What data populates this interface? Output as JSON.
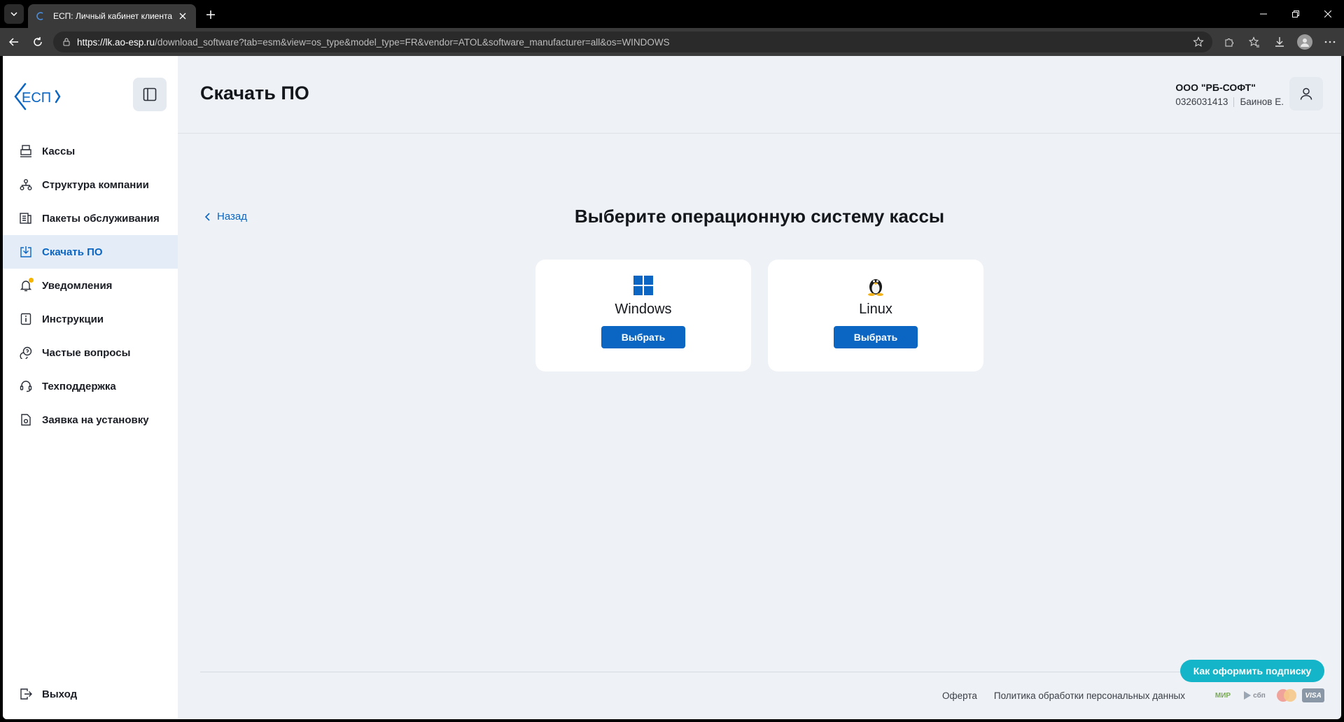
{
  "browser": {
    "tab_title": "ЕСП: Личный кабинет клиента",
    "url_host": "https://lk.ao-esp.ru",
    "url_path": "/download_software?tab=esm&view=os_type&model_type=FR&vendor=ATOL&software_manufacturer=all&os=WINDOWS"
  },
  "app": {
    "logo_text": "ЕСП",
    "page_title": "Скачать ПО"
  },
  "sidebar": {
    "items": [
      {
        "label": "Кассы",
        "icon": "register-icon"
      },
      {
        "label": "Структура компании",
        "icon": "structure-icon"
      },
      {
        "label": "Пакеты обслуживания",
        "icon": "packages-icon"
      },
      {
        "label": "Скачать ПО",
        "icon": "download-icon",
        "active": true
      },
      {
        "label": "Уведомления",
        "icon": "bell-icon"
      },
      {
        "label": "Инструкции",
        "icon": "info-icon"
      },
      {
        "label": "Частые вопросы",
        "icon": "faq-icon"
      },
      {
        "label": "Техподдержка",
        "icon": "headset-icon"
      },
      {
        "label": "Заявка на установку",
        "icon": "request-icon"
      }
    ],
    "logout_label": "Выход"
  },
  "header": {
    "company_name": "ООО \"РБ-СОФТ\"",
    "inn": "0326031413",
    "user": "Баинов Е."
  },
  "content": {
    "back_label": "Назад",
    "section_title": "Выберите операционную систему кассы",
    "os_options": [
      {
        "name": "Windows",
        "button": "Выбрать"
      },
      {
        "name": "Linux",
        "button": "Выбрать"
      }
    ]
  },
  "footer": {
    "help_button": "Как оформить подписку",
    "links": [
      "Оферта",
      "Политика обработки персональных данных"
    ],
    "payments": {
      "mir": "МИР",
      "sbp": "сбп",
      "visa": "VISA"
    }
  },
  "colors": {
    "accent": "#0a66c2",
    "help": "#14b5c9",
    "notification_dot": "#f5b400"
  }
}
